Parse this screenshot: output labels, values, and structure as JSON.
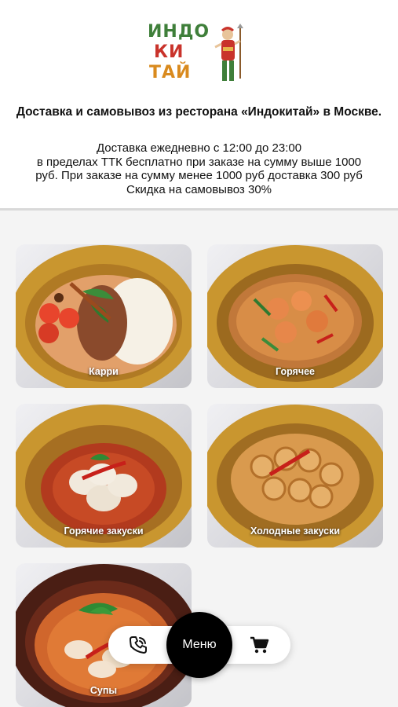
{
  "brand": {
    "logo_lines": [
      "ИНДО",
      "КИ",
      "ТАЙ"
    ]
  },
  "header": {
    "title": "Доставка и самовывоз из ресторана «Индокитай» в Москве.",
    "info_lines": [
      "Доставка ежедневно с 12:00 до 23:00",
      "в пределах ТТК бесплатно при заказе на сумму выше 1000",
      "руб. При заказе на сумму менее 1000 руб доставка 300 руб",
      "Скидка на самовывоз 30%"
    ]
  },
  "categories": [
    {
      "label": "Карри"
    },
    {
      "label": "Горячее"
    },
    {
      "label": "Горячие закуски"
    },
    {
      "label": "Холодные закуски"
    },
    {
      "label": "Супы"
    }
  ],
  "bottom_nav": {
    "menu_label": "Меню",
    "phone_icon": "phone-icon",
    "cart_icon": "cart-icon"
  },
  "colors": {
    "accent": "#000000",
    "bowl": "#c9962f",
    "background": "#f4f4f4"
  }
}
